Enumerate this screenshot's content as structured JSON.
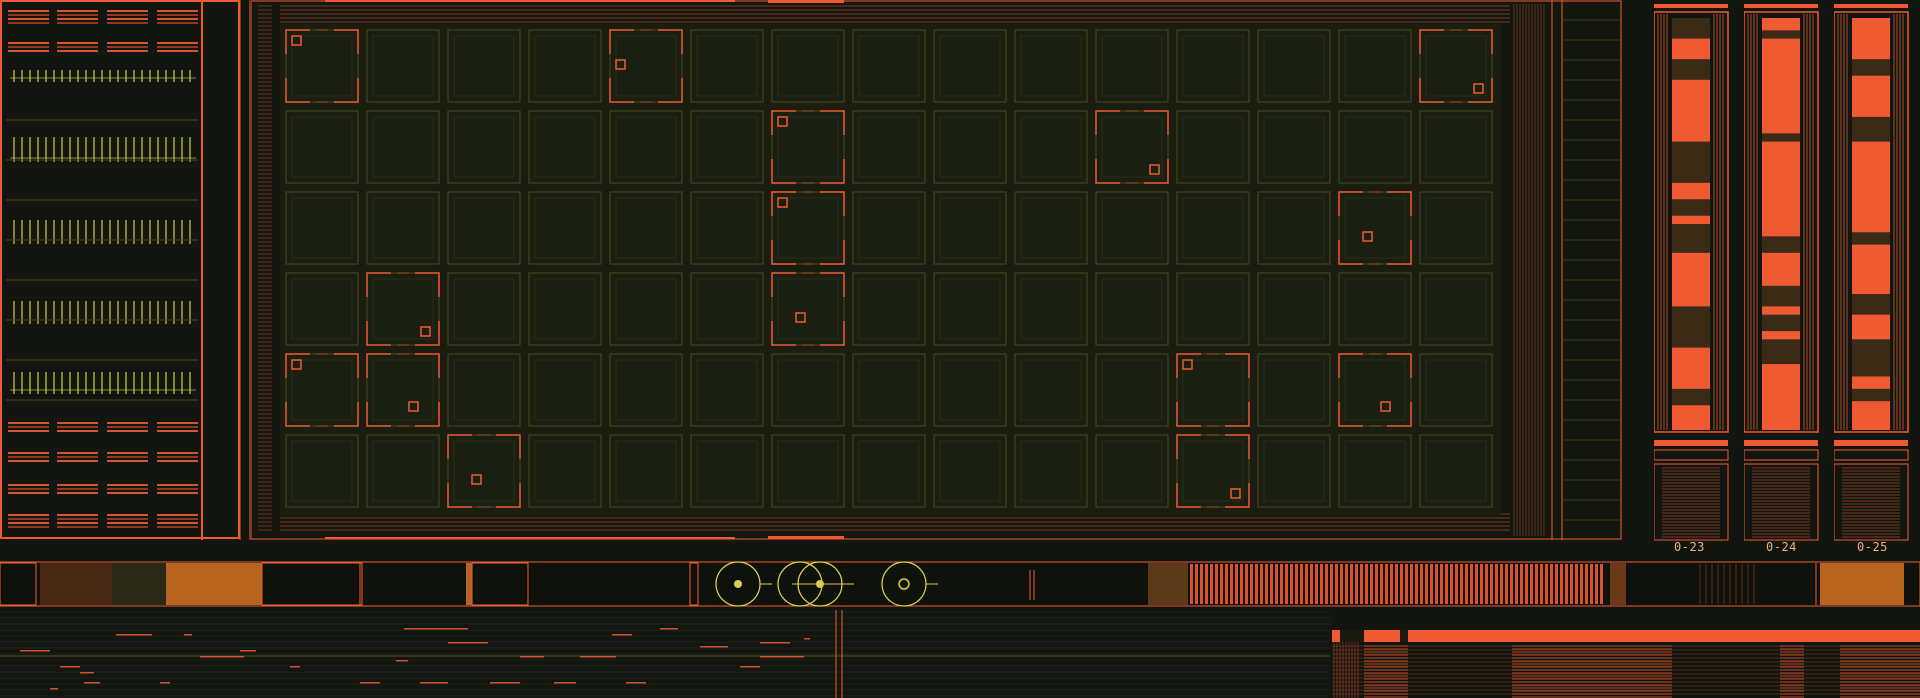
{
  "colors": {
    "background": "#121510",
    "accent": "#f05a32",
    "dim_accent": "#a84a26",
    "amber": "#b8661f",
    "yellow": "#d8d050",
    "grid": "#4a4a1c",
    "cell": "#1b1f12"
  },
  "grid": {
    "columns": 15,
    "rows": 6,
    "selected_cells": [
      [
        0,
        0,
        "tl"
      ],
      [
        0,
        4,
        "ml"
      ],
      [
        0,
        14,
        "br"
      ],
      [
        1,
        6,
        "tl"
      ],
      [
        1,
        10,
        "br"
      ],
      [
        2,
        6,
        "tl"
      ],
      [
        2,
        13,
        "mc"
      ],
      [
        3,
        1,
        "br"
      ],
      [
        3,
        6,
        "mc"
      ],
      [
        4,
        0,
        "tl"
      ],
      [
        4,
        1,
        "mr"
      ],
      [
        4,
        11,
        "tl"
      ],
      [
        4,
        13,
        "mr"
      ],
      [
        5,
        2,
        "mc"
      ],
      [
        5,
        11,
        "br"
      ]
    ]
  },
  "columns": [
    {
      "label": "0-23",
      "levels": [
        0,
        0.05,
        0.1,
        0.15,
        0.3,
        0.4,
        0.44,
        0.48,
        0.5,
        0.57,
        0.7,
        0.8,
        0.9,
        0.94
      ]
    },
    {
      "label": "0-24",
      "levels": [
        0.03,
        0.05,
        0.28,
        0.3,
        0.53,
        0.57,
        0.65,
        0.7,
        0.72,
        0.76,
        0.78,
        0.84,
        0.88
      ]
    },
    {
      "label": "0-25",
      "levels": [
        0.1,
        0.14,
        0.24,
        0.3,
        0.52,
        0.55,
        0.67,
        0.72,
        0.78,
        0.87,
        0.9,
        0.93
      ]
    }
  ]
}
